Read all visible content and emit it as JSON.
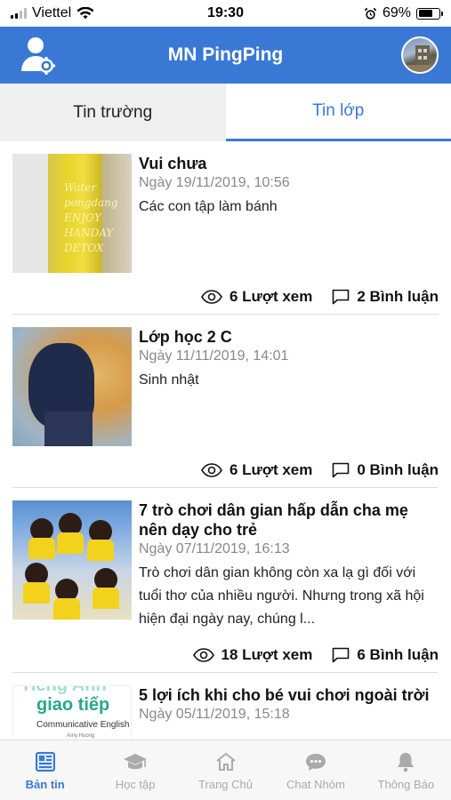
{
  "status_bar": {
    "carrier": "Viettel",
    "time": "19:30",
    "battery": "69%",
    "battery_level": 0.69
  },
  "header": {
    "title": "MN PingPing"
  },
  "tabs": [
    {
      "label": "Tin trường",
      "active": false
    },
    {
      "label": "Tin lớp",
      "active": true
    }
  ],
  "posts": [
    {
      "title": "Vui chưa",
      "date": "Ngày 19/11/2019, 10:56",
      "desc": "Các con tập làm bánh",
      "views": "6 Lượt xem",
      "comments": "2 Bình luận",
      "thumb_text": "Water pongdang ENJOY HANDAY DETOX"
    },
    {
      "title": "Lớp học 2 C",
      "date": "Ngày 11/11/2019, 14:01",
      "desc": "Sinh nhật",
      "views": "6 Lượt xem",
      "comments": "0 Bình luận"
    },
    {
      "title": "7 trò chơi dân gian hấp dẫn cha mẹ nên dạy cho trẻ",
      "date": "Ngày 07/11/2019, 16:13",
      "desc": "Trò chơi dân gian không còn xa lạ gì đối với tuổi thơ của nhiều người. Nhưng trong xã hội hiện đại ngày nay, chúng l...",
      "views": "18 Lượt xem",
      "comments": "6 Bình luận"
    },
    {
      "title": "5 lợi ích khi cho bé vui chơi ngoài trời",
      "date": "Ngày 05/11/2019, 15:18",
      "thumb_text": {
        "line1": "Tiếng Anh",
        "line2": "giao tiếp",
        "line3": "Communicative English",
        "line4": "Amy Huong"
      }
    }
  ],
  "bottom_nav": [
    {
      "label": "Bản tin",
      "icon": "newspaper-icon",
      "active": true
    },
    {
      "label": "Học tập",
      "icon": "graduation-cap-icon",
      "active": false
    },
    {
      "label": "Trang Chủ",
      "icon": "home-icon",
      "active": false
    },
    {
      "label": "Chat Nhóm",
      "icon": "chat-bubble-icon",
      "active": false
    },
    {
      "label": "Thông Báo",
      "icon": "bell-icon",
      "active": false
    }
  ],
  "colors": {
    "primary": "#3a78d6",
    "tab_inactive_bg": "#efefef",
    "date_gray": "#888888"
  }
}
